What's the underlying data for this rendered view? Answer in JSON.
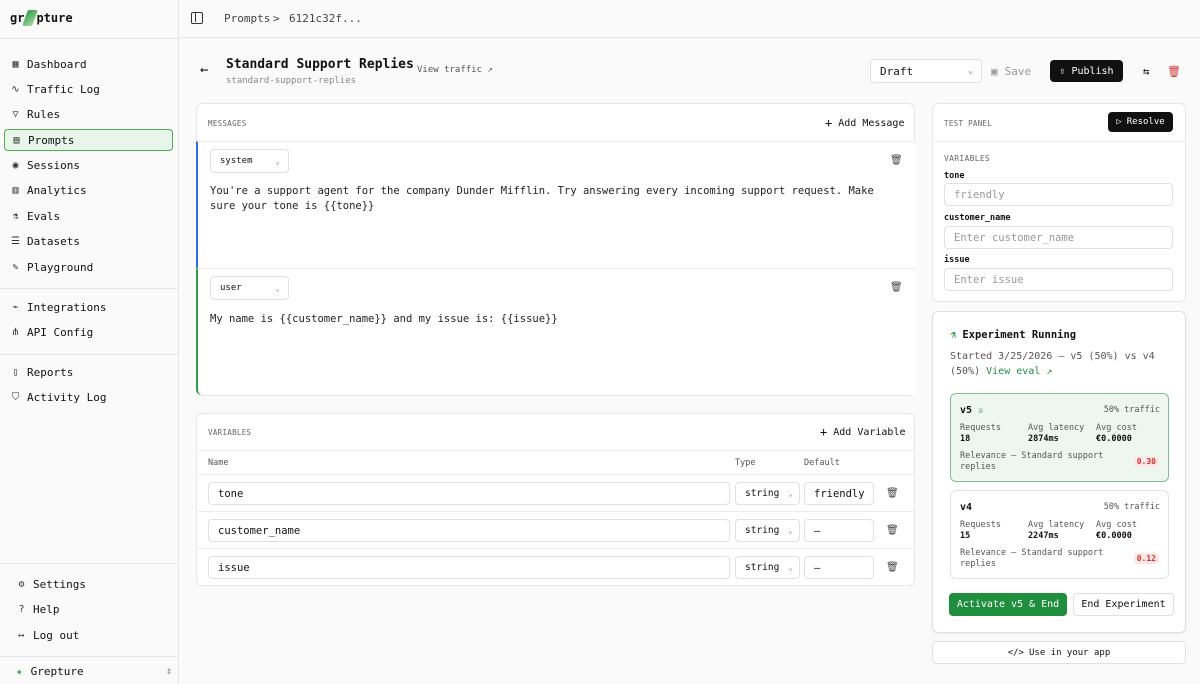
{
  "app": {
    "name_left": "gr",
    "name_right": "pture",
    "workspace": "Grepture"
  },
  "sidebar": {
    "items": [
      {
        "label": "Dashboard",
        "icon": "grid-icon"
      },
      {
        "label": "Traffic Log",
        "icon": "activity-icon"
      },
      {
        "label": "Rules",
        "icon": "filter-icon"
      },
      {
        "label": "Prompts",
        "icon": "message-square-icon"
      },
      {
        "label": "Sessions",
        "icon": "radio-icon"
      },
      {
        "label": "Analytics",
        "icon": "bar-chart-icon"
      },
      {
        "label": "Evals",
        "icon": "flask-icon"
      },
      {
        "label": "Datasets",
        "icon": "database-icon"
      },
      {
        "label": "Playground",
        "icon": "pen-icon"
      },
      {
        "label": "Integrations",
        "icon": "plug-icon"
      },
      {
        "label": "API Config",
        "icon": "network-icon"
      },
      {
        "label": "Reports",
        "icon": "file-icon"
      },
      {
        "label": "Activity Log",
        "icon": "shield-icon"
      }
    ],
    "bottom": [
      {
        "label": "Settings",
        "icon": "gear-icon"
      },
      {
        "label": "Help",
        "icon": "help-circle-icon"
      },
      {
        "label": "Log out",
        "icon": "logout-icon"
      }
    ]
  },
  "breadcrumb": {
    "root": "Prompts",
    "sep": ">",
    "current": "6121c32f..."
  },
  "header": {
    "title": "Standard Support Replies",
    "slug": "standard-support-replies",
    "view_traffic": "View traffic",
    "status_select": "Draft",
    "save": "Save",
    "publish": "Publish"
  },
  "messages": {
    "section_label": "MESSAGES",
    "add_label": "Add Message",
    "items": [
      {
        "role": "system",
        "text": "You're a support agent for the company Dunder Mifflin. Try answering every incoming support request. Make sure your tone is {{tone}}",
        "accent": "#2f6fe4"
      },
      {
        "role": "user",
        "text": "My name is {{customer_name}} and my issue is: {{issue}}",
        "accent": "#2e9e4a"
      }
    ]
  },
  "variables": {
    "section_label": "VARIABLES",
    "add_label": "Add Variable",
    "col_name": "Name",
    "col_type": "Type",
    "col_default": "Default",
    "rows": [
      {
        "name": "tone",
        "type": "string",
        "default": "friendly"
      },
      {
        "name": "customer_name",
        "type": "string",
        "default": "—"
      },
      {
        "name": "issue",
        "type": "string",
        "default": "—"
      }
    ]
  },
  "test_panel": {
    "label": "TEST PANEL",
    "resolve": "Resolve",
    "variables_label": "VARIABLES",
    "fields": [
      {
        "name": "tone",
        "value": "friendly",
        "placeholder": ""
      },
      {
        "name": "customer_name",
        "value": "",
        "placeholder": "Enter customer_name"
      },
      {
        "name": "issue",
        "value": "",
        "placeholder": "Enter issue"
      }
    ]
  },
  "experiment": {
    "title": "Experiment Running",
    "started_line1": "Started 3/25/2026 — v5 (50%) vs v4",
    "started_line2": "(50%)",
    "view_eval": "View eval",
    "variants": [
      {
        "name": "v5",
        "traffic": "50% traffic",
        "requests_label": "Requests",
        "requests": "18",
        "latency_label": "Avg latency",
        "latency": "2874ms",
        "cost_label": "Avg cost",
        "cost": "€0.0000",
        "relevance_line1": "Relevance — Standard support",
        "relevance_line2": "replies",
        "score": "0.30",
        "winner": true
      },
      {
        "name": "v4",
        "traffic": "50% traffic",
        "requests_label": "Requests",
        "requests": "15",
        "latency_label": "Avg latency",
        "latency": "2247ms",
        "cost_label": "Avg cost",
        "cost": "€0.0000",
        "relevance_line1": "Relevance — Standard support",
        "relevance_line2": "replies",
        "score": "0.12",
        "winner": false
      }
    ],
    "activate": "Activate v5 & End",
    "end": "End Experiment"
  },
  "use_in_app": "Use in your app"
}
